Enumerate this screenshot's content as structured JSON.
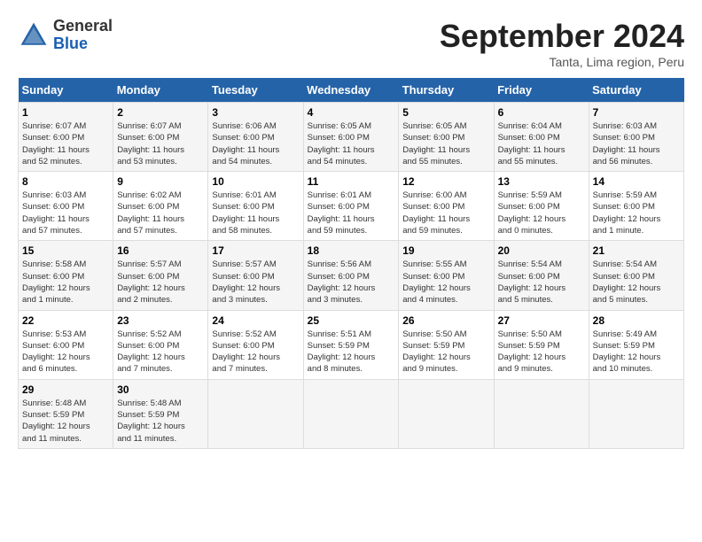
{
  "header": {
    "logo_general": "General",
    "logo_blue": "Blue",
    "title": "September 2024",
    "location": "Tanta, Lima region, Peru"
  },
  "weekdays": [
    "Sunday",
    "Monday",
    "Tuesday",
    "Wednesday",
    "Thursday",
    "Friday",
    "Saturday"
  ],
  "weeks": [
    [
      {
        "day": "1",
        "info": "Sunrise: 6:07 AM\nSunset: 6:00 PM\nDaylight: 11 hours\nand 52 minutes."
      },
      {
        "day": "2",
        "info": "Sunrise: 6:07 AM\nSunset: 6:00 PM\nDaylight: 11 hours\nand 53 minutes."
      },
      {
        "day": "3",
        "info": "Sunrise: 6:06 AM\nSunset: 6:00 PM\nDaylight: 11 hours\nand 54 minutes."
      },
      {
        "day": "4",
        "info": "Sunrise: 6:05 AM\nSunset: 6:00 PM\nDaylight: 11 hours\nand 54 minutes."
      },
      {
        "day": "5",
        "info": "Sunrise: 6:05 AM\nSunset: 6:00 PM\nDaylight: 11 hours\nand 55 minutes."
      },
      {
        "day": "6",
        "info": "Sunrise: 6:04 AM\nSunset: 6:00 PM\nDaylight: 11 hours\nand 55 minutes."
      },
      {
        "day": "7",
        "info": "Sunrise: 6:03 AM\nSunset: 6:00 PM\nDaylight: 11 hours\nand 56 minutes."
      }
    ],
    [
      {
        "day": "8",
        "info": "Sunrise: 6:03 AM\nSunset: 6:00 PM\nDaylight: 11 hours\nand 57 minutes."
      },
      {
        "day": "9",
        "info": "Sunrise: 6:02 AM\nSunset: 6:00 PM\nDaylight: 11 hours\nand 57 minutes."
      },
      {
        "day": "10",
        "info": "Sunrise: 6:01 AM\nSunset: 6:00 PM\nDaylight: 11 hours\nand 58 minutes."
      },
      {
        "day": "11",
        "info": "Sunrise: 6:01 AM\nSunset: 6:00 PM\nDaylight: 11 hours\nand 59 minutes."
      },
      {
        "day": "12",
        "info": "Sunrise: 6:00 AM\nSunset: 6:00 PM\nDaylight: 11 hours\nand 59 minutes."
      },
      {
        "day": "13",
        "info": "Sunrise: 5:59 AM\nSunset: 6:00 PM\nDaylight: 12 hours\nand 0 minutes."
      },
      {
        "day": "14",
        "info": "Sunrise: 5:59 AM\nSunset: 6:00 PM\nDaylight: 12 hours\nand 1 minute."
      }
    ],
    [
      {
        "day": "15",
        "info": "Sunrise: 5:58 AM\nSunset: 6:00 PM\nDaylight: 12 hours\nand 1 minute."
      },
      {
        "day": "16",
        "info": "Sunrise: 5:57 AM\nSunset: 6:00 PM\nDaylight: 12 hours\nand 2 minutes."
      },
      {
        "day": "17",
        "info": "Sunrise: 5:57 AM\nSunset: 6:00 PM\nDaylight: 12 hours\nand 3 minutes."
      },
      {
        "day": "18",
        "info": "Sunrise: 5:56 AM\nSunset: 6:00 PM\nDaylight: 12 hours\nand 3 minutes."
      },
      {
        "day": "19",
        "info": "Sunrise: 5:55 AM\nSunset: 6:00 PM\nDaylight: 12 hours\nand 4 minutes."
      },
      {
        "day": "20",
        "info": "Sunrise: 5:54 AM\nSunset: 6:00 PM\nDaylight: 12 hours\nand 5 minutes."
      },
      {
        "day": "21",
        "info": "Sunrise: 5:54 AM\nSunset: 6:00 PM\nDaylight: 12 hours\nand 5 minutes."
      }
    ],
    [
      {
        "day": "22",
        "info": "Sunrise: 5:53 AM\nSunset: 6:00 PM\nDaylight: 12 hours\nand 6 minutes."
      },
      {
        "day": "23",
        "info": "Sunrise: 5:52 AM\nSunset: 6:00 PM\nDaylight: 12 hours\nand 7 minutes."
      },
      {
        "day": "24",
        "info": "Sunrise: 5:52 AM\nSunset: 6:00 PM\nDaylight: 12 hours\nand 7 minutes."
      },
      {
        "day": "25",
        "info": "Sunrise: 5:51 AM\nSunset: 5:59 PM\nDaylight: 12 hours\nand 8 minutes."
      },
      {
        "day": "26",
        "info": "Sunrise: 5:50 AM\nSunset: 5:59 PM\nDaylight: 12 hours\nand 9 minutes."
      },
      {
        "day": "27",
        "info": "Sunrise: 5:50 AM\nSunset: 5:59 PM\nDaylight: 12 hours\nand 9 minutes."
      },
      {
        "day": "28",
        "info": "Sunrise: 5:49 AM\nSunset: 5:59 PM\nDaylight: 12 hours\nand 10 minutes."
      }
    ],
    [
      {
        "day": "29",
        "info": "Sunrise: 5:48 AM\nSunset: 5:59 PM\nDaylight: 12 hours\nand 11 minutes."
      },
      {
        "day": "30",
        "info": "Sunrise: 5:48 AM\nSunset: 5:59 PM\nDaylight: 12 hours\nand 11 minutes."
      },
      null,
      null,
      null,
      null,
      null
    ]
  ]
}
